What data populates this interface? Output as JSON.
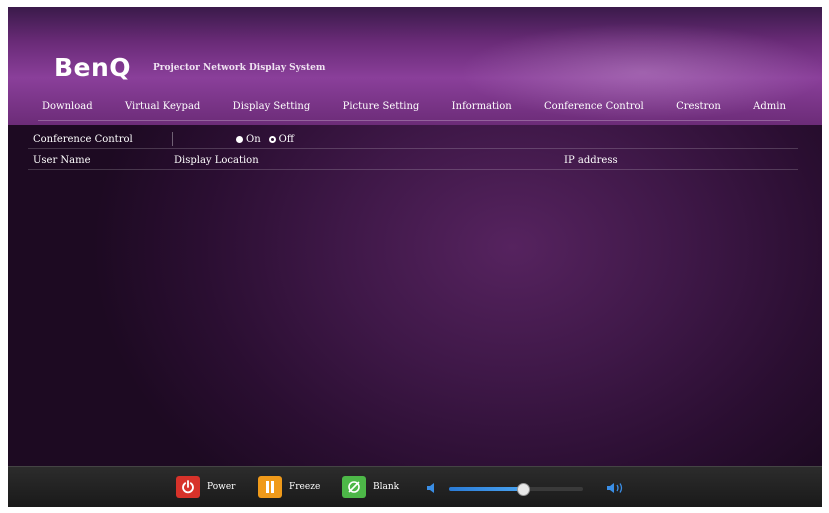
{
  "header": {
    "logo": "BenQ",
    "subtitle": "Projector Network Display System"
  },
  "nav": [
    "Download",
    "Virtual Keypad",
    "Display Setting",
    "Picture Setting",
    "Information",
    "Conference Control",
    "Crestron",
    "Admin"
  ],
  "conference": {
    "label": "Conference Control",
    "on_label": "On",
    "off_label": "Off",
    "selected": "Off"
  },
  "table": {
    "headers": [
      "User Name",
      "Display Location",
      "IP address"
    ]
  },
  "footer": {
    "power_label": "Power",
    "freeze_label": "Freeze",
    "blank_label": "Blank",
    "volume_level": 0.55
  },
  "colors": {
    "power": "#d7322a",
    "freeze": "#f09a1a",
    "blank": "#4db848",
    "accent": "#2a7bd6"
  },
  "icons": {
    "power": "power-icon",
    "freeze": "pause-icon",
    "blank": "blank-screen-icon",
    "volume_low": "volume-low-icon",
    "volume_high": "volume-high-icon"
  }
}
